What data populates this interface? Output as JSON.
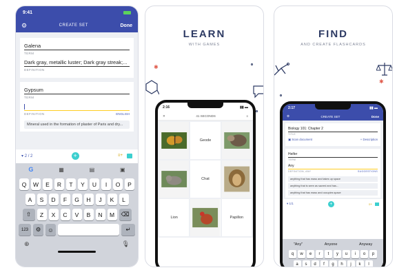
{
  "screen1": {
    "status_time": "9:41",
    "title": "CREATE SET",
    "done": "Done",
    "card1": {
      "term": "Galena",
      "term_label": "TERM",
      "definition": "Dark gray, metallic luster; Dark gray streak;...",
      "definition_label": "DEFINITION"
    },
    "card2": {
      "term": "Gypsum",
      "term_label": "TERM",
      "definition": "",
      "definition_label": "DEFINITION",
      "language": "ENGLISH",
      "suggestion": "Mineral used in the formation of plaster of Paris and dry..."
    },
    "toolbar": {
      "count": "2 / 2"
    },
    "keyboard": {
      "row1": [
        "Q",
        "W",
        "E",
        "R",
        "T",
        "Y",
        "U",
        "I",
        "O",
        "P"
      ],
      "row2": [
        "A",
        "S",
        "D",
        "F",
        "G",
        "H",
        "J",
        "K",
        "L"
      ],
      "row3": [
        "Z",
        "X",
        "C",
        "V",
        "B",
        "N",
        "M"
      ],
      "numbers_key": "123"
    }
  },
  "screen2": {
    "headline": "LEARN",
    "subline": "WITH GAMES",
    "phone_time": "2:16",
    "timer": "41 SECONDS",
    "tiles": [
      "",
      "Geode",
      "",
      "",
      "Chat",
      "",
      "Lion",
      "",
      "Papillon"
    ]
  },
  "screen3": {
    "headline": "FIND",
    "subline": "AND CREATE FLASHCARDS",
    "phone_time": "2:17",
    "title": "CREATE SET",
    "done": "Done",
    "set_title": "Biology 101: Chapter 2",
    "set_title_label": "TITLE",
    "scan_label": "Scan document",
    "description_label": "+ Description",
    "term": "Heifer",
    "term_label": "TERM",
    "definition": "Any",
    "definition_label": "DEFINITION, ANY",
    "suggestions_label": "SUGGESTIONS",
    "suggestions": [
      "anything that has mass and takes up space",
      "anything that is seen as sacred and has...",
      "anything that has mass and occupies space"
    ],
    "kb_suggestions": [
      "\"Any\"",
      "Anyone",
      "Anyway"
    ],
    "kb_row1": [
      "q",
      "w",
      "e",
      "r",
      "t",
      "y",
      "u",
      "i",
      "o",
      "p"
    ],
    "kb_row2": [
      "a",
      "s",
      "d",
      "f",
      "g",
      "h",
      "j",
      "k",
      "l"
    ]
  },
  "colors": {
    "brand": "#3c4dab",
    "accent_yellow": "#ffcd1f",
    "teal": "#3ccfcf",
    "title_text": "#2d3a63"
  }
}
